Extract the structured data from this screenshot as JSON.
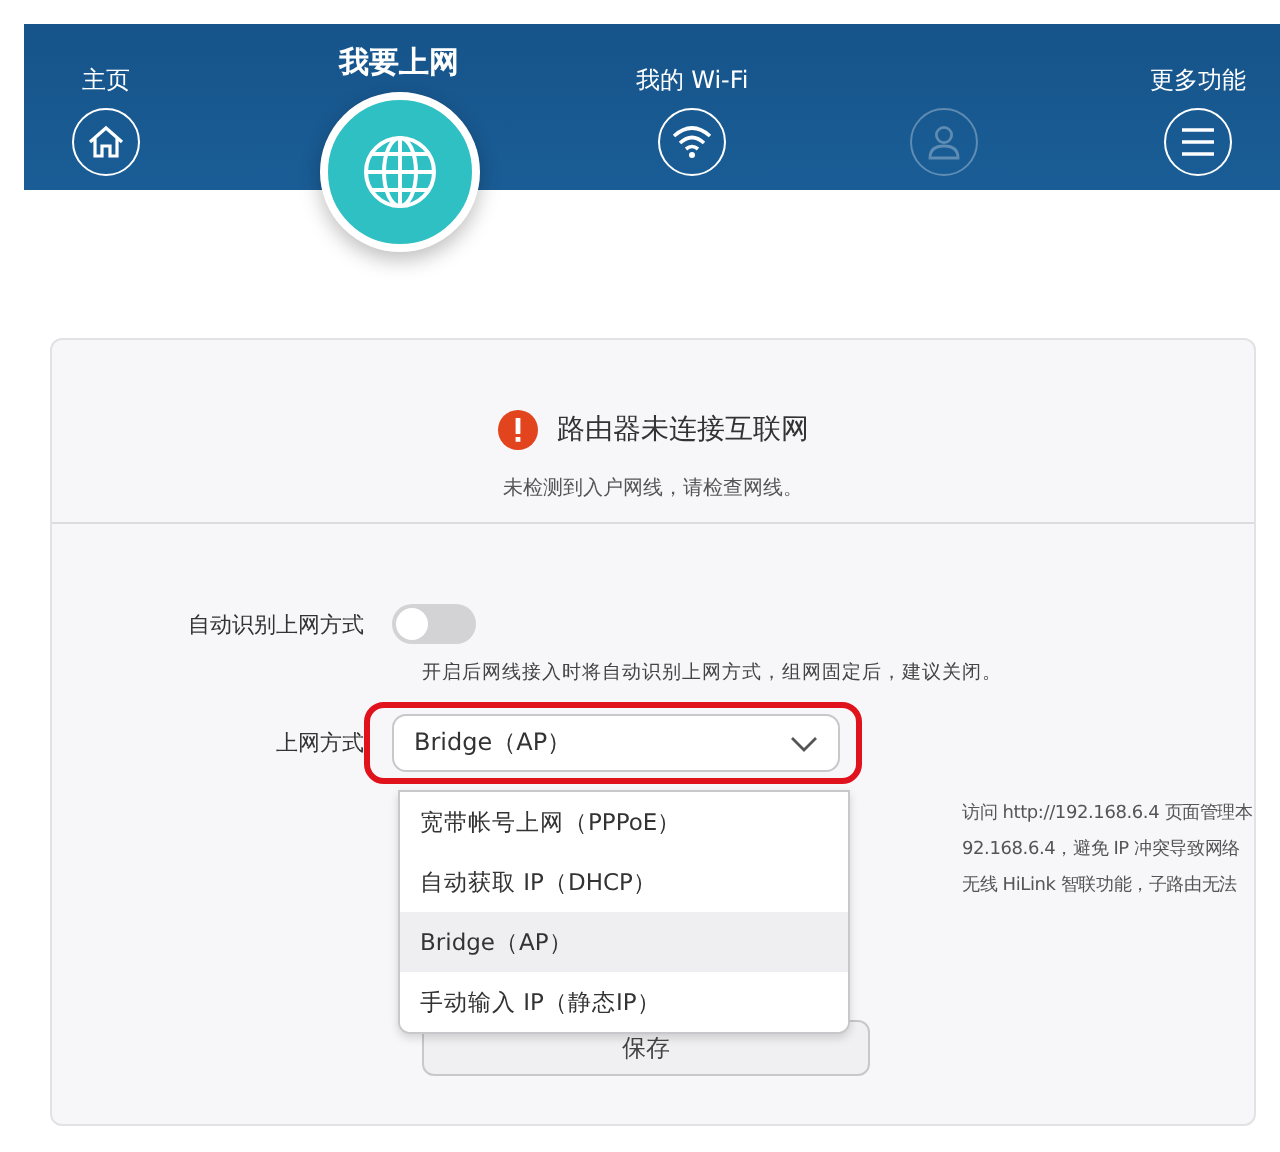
{
  "nav": [
    {
      "label": "主页",
      "kind": "home",
      "selected": false,
      "disabled": false
    },
    {
      "label": "我要上网",
      "kind": "globe",
      "selected": true,
      "disabled": false
    },
    {
      "label": "我的 Wi-Fi",
      "kind": "wifi",
      "selected": false,
      "disabled": false
    },
    {
      "kind": "user",
      "selected": false,
      "disabled": true
    },
    {
      "label": "更多功能",
      "kind": "menu",
      "selected": false,
      "disabled": false
    }
  ],
  "status": {
    "title": "路由器未连接互联网",
    "message": "未检测到入户网线，请检查网线。"
  },
  "auto_detect": {
    "label": "自动识别上网方式",
    "on": false,
    "hint": "开启后网线接入时将自动识别上网方式，组网固定后，建议关闭。"
  },
  "mode": {
    "label": "上网方式",
    "value": "Bridge（AP）",
    "highlighted": true,
    "expanded": true,
    "options": [
      {
        "label": "宽带帐号上网（PPPoE）",
        "selected": false
      },
      {
        "label": "自动获取 IP（DHCP）",
        "selected": false
      },
      {
        "label": "Bridge（AP）",
        "selected": true
      },
      {
        "label": "手动输入 IP（静态IP）",
        "selected": false
      }
    ]
  },
  "help_text": [
    "访问 http://192.168.6.4 页面管理本",
    "92.168.6.4，避免 IP 冲突导致网络",
    "无线 HiLink 智联功能，子路由无法"
  ],
  "save_button": "保存"
}
